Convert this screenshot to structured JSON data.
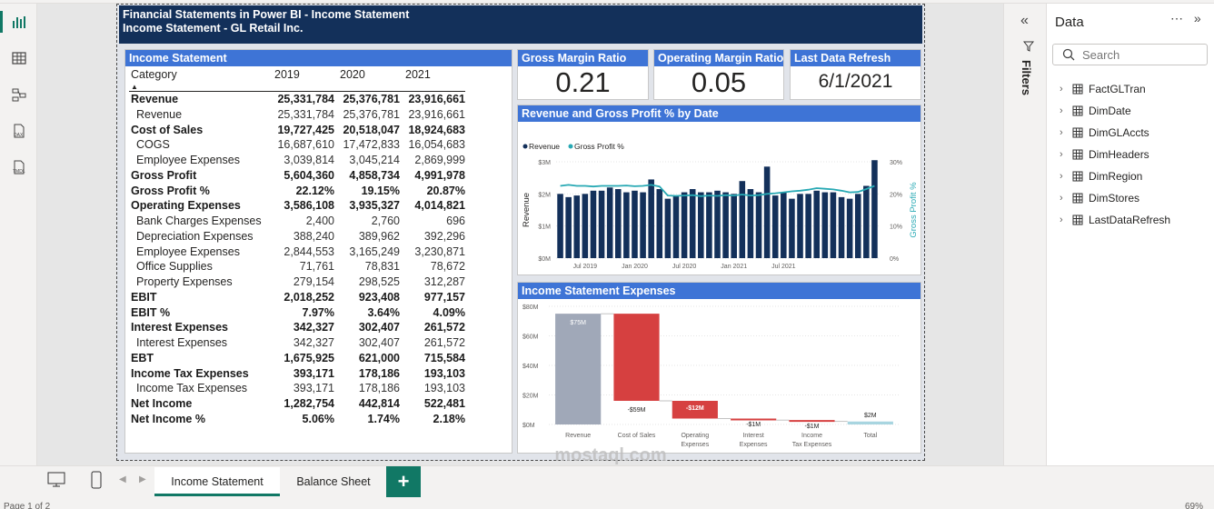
{
  "report": {
    "title_line1": "Financial Statements in Power BI - Income Statement",
    "title_line2": "Income Statement - GL Retail Inc."
  },
  "income_statement": {
    "header": "Income Statement",
    "columns": [
      "Category",
      "2019",
      "2020",
      "2021"
    ],
    "rows": [
      {
        "label": "Revenue",
        "bold": true,
        "v": [
          "25,331,784",
          "25,376,781",
          "23,916,661"
        ]
      },
      {
        "label": "Revenue",
        "bold": false,
        "v": [
          "25,331,784",
          "25,376,781",
          "23,916,661"
        ]
      },
      {
        "label": "Cost of Sales",
        "bold": true,
        "v": [
          "19,727,425",
          "20,518,047",
          "18,924,683"
        ]
      },
      {
        "label": "COGS",
        "bold": false,
        "v": [
          "16,687,610",
          "17,472,833",
          "16,054,683"
        ]
      },
      {
        "label": "Employee Expenses",
        "bold": false,
        "v": [
          "3,039,814",
          "3,045,214",
          "2,869,999"
        ]
      },
      {
        "label": "Gross Profit",
        "bold": true,
        "v": [
          "5,604,360",
          "4,858,734",
          "4,991,978"
        ]
      },
      {
        "label": "Gross Profit %",
        "bold": true,
        "v": [
          "22.12%",
          "19.15%",
          "20.87%"
        ]
      },
      {
        "label": "Operating Expenses",
        "bold": true,
        "v": [
          "3,586,108",
          "3,935,327",
          "4,014,821"
        ]
      },
      {
        "label": "Bank Charges Expenses",
        "bold": false,
        "v": [
          "2,400",
          "2,760",
          "696"
        ]
      },
      {
        "label": "Depreciation Expenses",
        "bold": false,
        "v": [
          "388,240",
          "389,962",
          "392,296"
        ]
      },
      {
        "label": "Employee Expenses",
        "bold": false,
        "v": [
          "2,844,553",
          "3,165,249",
          "3,230,871"
        ]
      },
      {
        "label": "Office Supplies",
        "bold": false,
        "v": [
          "71,761",
          "78,831",
          "78,672"
        ]
      },
      {
        "label": "Property Expenses",
        "bold": false,
        "v": [
          "279,154",
          "298,525",
          "312,287"
        ]
      },
      {
        "label": "EBIT",
        "bold": true,
        "v": [
          "2,018,252",
          "923,408",
          "977,157"
        ]
      },
      {
        "label": "EBIT %",
        "bold": true,
        "v": [
          "7.97%",
          "3.64%",
          "4.09%"
        ]
      },
      {
        "label": "Interest Expenses",
        "bold": true,
        "v": [
          "342,327",
          "302,407",
          "261,572"
        ]
      },
      {
        "label": "Interest Expenses",
        "bold": false,
        "v": [
          "342,327",
          "302,407",
          "261,572"
        ]
      },
      {
        "label": "EBT",
        "bold": true,
        "v": [
          "1,675,925",
          "621,000",
          "715,584"
        ]
      },
      {
        "label": "Income Tax Expenses",
        "bold": true,
        "v": [
          "393,171",
          "178,186",
          "193,103"
        ]
      },
      {
        "label": "Income Tax Expenses",
        "bold": false,
        "v": [
          "393,171",
          "178,186",
          "193,103"
        ]
      },
      {
        "label": "Net Income",
        "bold": true,
        "v": [
          "1,282,754",
          "442,814",
          "522,481"
        ]
      },
      {
        "label": "Net Income %",
        "bold": true,
        "v": [
          "5.06%",
          "1.74%",
          "2.18%"
        ]
      }
    ]
  },
  "cards": {
    "gross_margin": {
      "label": "Gross Margin Ratio",
      "value": "0.21"
    },
    "operating_margin": {
      "label": "Operating Margin Ratio",
      "value": "0.05"
    },
    "last_refresh": {
      "label": "Last Data Refresh",
      "value": "6/1/2021"
    }
  },
  "chart_data": [
    {
      "type": "bar",
      "title": "Revenue and Gross Profit % by Date",
      "legend": [
        "Revenue",
        "Gross Profit %"
      ],
      "legend_position": "top-left",
      "ylabel": "Revenue",
      "y2label": "Gross Profit %",
      "y_ticks": [
        "$0M",
        "$1M",
        "$2M",
        "$3M"
      ],
      "y2_ticks": [
        "0%",
        "10%",
        "20%",
        "30%"
      ],
      "x_ticks": [
        "Jul 2019",
        "Jan 2020",
        "Jul 2020",
        "Jan 2021",
        "Jul 2021"
      ],
      "ylim": [
        0,
        3
      ],
      "y2lim": [
        0,
        30
      ],
      "series": [
        {
          "name": "Revenue",
          "color": "#13305a",
          "values": [
            2.0,
            1.9,
            1.95,
            2.0,
            2.1,
            2.1,
            2.2,
            2.15,
            2.05,
            2.1,
            2.05,
            2.45,
            2.15,
            1.85,
            1.95,
            2.05,
            2.15,
            2.05,
            2.05,
            2.1,
            2.05,
            2.0,
            2.4,
            2.15,
            2.05,
            2.85,
            1.95,
            2.05,
            1.85,
            2.0,
            2.0,
            2.1,
            2.05,
            2.05,
            1.9,
            1.85,
            2.0,
            2.25,
            3.05
          ]
        },
        {
          "name": "Gross Profit %",
          "color": "#28a9b4",
          "values": [
            22.5,
            22.8,
            22.5,
            22.5,
            22.3,
            22.5,
            22.5,
            22.5,
            22.6,
            22.4,
            22.5,
            22.8,
            22.3,
            19.5,
            19.4,
            19.5,
            19.6,
            19.3,
            19.5,
            19.4,
            19.6,
            19.5,
            19.8,
            19.5,
            19.6,
            20.0,
            20.2,
            20.5,
            20.8,
            21.0,
            21.3,
            21.8,
            21.6,
            21.4,
            21.0,
            20.5,
            20.6,
            21.5,
            22.5
          ]
        }
      ]
    },
    {
      "type": "waterfall",
      "title": "Income Statement Expenses",
      "y_ticks": [
        "$0M",
        "$20M",
        "$40M",
        "$60M",
        "$80M"
      ],
      "ylim": [
        0,
        80
      ],
      "categories": [
        "Revenue",
        "Cost of Sales",
        "Operating Expenses",
        "Interest Expenses",
        "Income Tax Expenses",
        "Total"
      ],
      "values": [
        75,
        -59,
        -12,
        -1,
        -1,
        2
      ],
      "data_labels": [
        "$75M",
        "-$59M",
        "-$12M",
        "-$1M",
        "-$1M",
        "$2M"
      ],
      "colors": {
        "start": "#a0a8b8",
        "decrease": "#d64040",
        "total": "#a8d5e0"
      }
    }
  ],
  "data_panel": {
    "title": "Data",
    "search_placeholder": "Search",
    "tables": [
      "FactGLTran",
      "DimDate",
      "DimGLAccts",
      "DimHeaders",
      "DimRegion",
      "DimStores",
      "LastDataRefresh"
    ]
  },
  "filters_label": "Filters",
  "tabs": {
    "income": "Income Statement",
    "balance": "Balance Sheet",
    "add": "+"
  },
  "status": {
    "page": "Page 1 of 2",
    "zoom": "69%"
  },
  "watermark": "mostaql.com"
}
